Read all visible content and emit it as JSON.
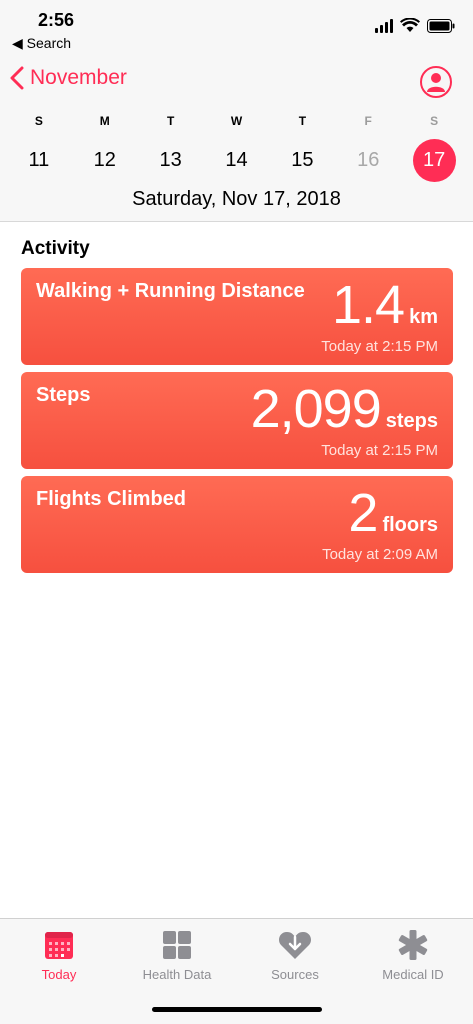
{
  "status_bar": {
    "time": "2:56",
    "back_label": "◀ Search"
  },
  "header": {
    "month_label": "November",
    "weekdays": [
      "S",
      "M",
      "T",
      "W",
      "T",
      "F",
      "S"
    ],
    "dates": [
      "11",
      "12",
      "13",
      "14",
      "15",
      "16",
      "17"
    ],
    "selected_date": "Saturday, Nov 17, 2018"
  },
  "activity": {
    "title": "Activity",
    "cards": [
      {
        "name": "Walking + Running Distance",
        "value": "1.4",
        "unit": "km",
        "time": "Today at 2:15 PM"
      },
      {
        "name": "Steps",
        "value": "2,099",
        "unit": "steps",
        "time": "Today at 2:15 PM"
      },
      {
        "name": "Flights Climbed",
        "value": "2",
        "unit": "floors",
        "time": "Today at 2:09 AM"
      }
    ]
  },
  "tabs": [
    {
      "label": "Today",
      "icon": "calendar-icon"
    },
    {
      "label": "Health Data",
      "icon": "grid-icon"
    },
    {
      "label": "Sources",
      "icon": "heart-download-icon"
    },
    {
      "label": "Medical ID",
      "icon": "asterisk-icon"
    }
  ],
  "colors": {
    "accent": "#ff2d55",
    "card": "#f6503f",
    "inactive": "#8e8e93"
  }
}
